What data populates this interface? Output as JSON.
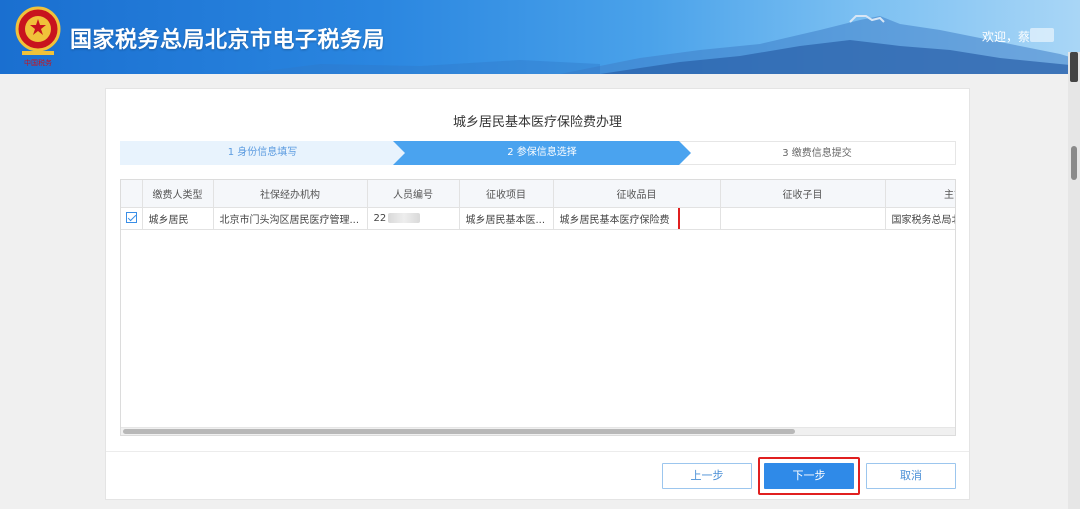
{
  "header": {
    "site_title": "国家税务总局北京市电子税务局",
    "welcome": "欢迎，蔡",
    "emblem_icon": "tax-emblem-icon"
  },
  "panel": {
    "title": "城乡居民基本医疗保险费办理"
  },
  "steps": [
    {
      "label": "1 身份信息填写",
      "state": "done"
    },
    {
      "label": "2 参保信息选择",
      "state": "active"
    },
    {
      "label": "3 缴费信息提交",
      "state": "pending"
    }
  ],
  "table": {
    "headers": [
      "缴费人类型",
      "社保经办机构",
      "人员编号",
      "征收项目",
      "征收品目",
      "征收子目",
      "主管"
    ],
    "rows": [
      {
        "checked": true,
        "payer_type": "城乡居民",
        "agency": "北京市门头沟区居民医疗管理...",
        "person_id": "22",
        "levy_item": "城乡居民基本医...",
        "levy_category": "城乡居民基本医疗保险费",
        "levy_subitem": "",
        "authority": "国家税务总局北"
      }
    ]
  },
  "buttons": {
    "prev": "上一步",
    "next": "下一步",
    "cancel": "取消"
  },
  "colors": {
    "accent": "#2f8ae8",
    "highlight": "#e01f1f",
    "header": "#1a6fd0"
  }
}
